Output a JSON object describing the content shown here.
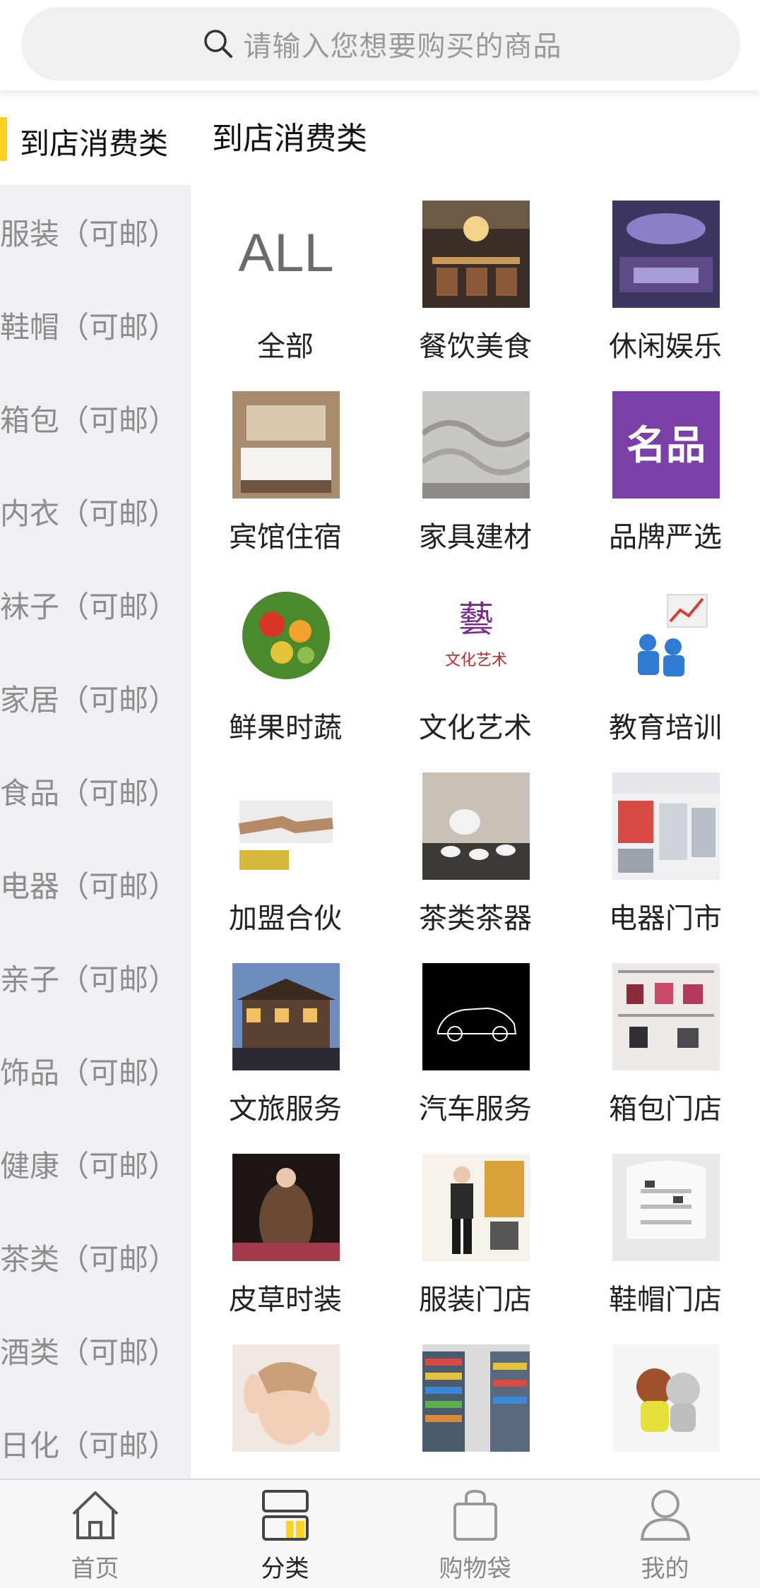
{
  "search": {
    "placeholder": "请输入您想要购买的商品",
    "icon": "search-icon"
  },
  "sidebar": {
    "active_label": "到店消费类",
    "items": [
      {
        "label": "服装（可邮）"
      },
      {
        "label": "鞋帽（可邮）"
      },
      {
        "label": "箱包（可邮）"
      },
      {
        "label": "内衣（可邮）"
      },
      {
        "label": "袜子（可邮）"
      },
      {
        "label": "家居（可邮）"
      },
      {
        "label": "食品（可邮）"
      },
      {
        "label": "电器（可邮）"
      },
      {
        "label": "亲子（可邮）"
      },
      {
        "label": "饰品（可邮）"
      },
      {
        "label": "健康（可邮）"
      },
      {
        "label": "茶类（可邮）"
      },
      {
        "label": "酒类（可邮）"
      },
      {
        "label": "日化（可邮）"
      }
    ]
  },
  "main": {
    "title": "到店消费类",
    "categories": [
      {
        "label": "全部",
        "thumb_text": "ALL"
      },
      {
        "label": "餐饮美食"
      },
      {
        "label": "休闲娱乐"
      },
      {
        "label": "宾馆住宿"
      },
      {
        "label": "家具建材"
      },
      {
        "label": "品牌严选",
        "thumb_text": "名品"
      },
      {
        "label": "鲜果时蔬"
      },
      {
        "label": "文化艺术",
        "thumb_text": "文化艺术"
      },
      {
        "label": "教育培训"
      },
      {
        "label": "加盟合伙"
      },
      {
        "label": "茶类茶器"
      },
      {
        "label": "电器门市"
      },
      {
        "label": "文旅服务"
      },
      {
        "label": "汽车服务"
      },
      {
        "label": "箱包门店"
      },
      {
        "label": "皮草时装"
      },
      {
        "label": "服装门店"
      },
      {
        "label": "鞋帽门店"
      },
      {
        "label": ""
      },
      {
        "label": ""
      },
      {
        "label": ""
      }
    ]
  },
  "tabbar": {
    "tabs": [
      {
        "label": "首页",
        "icon": "home-icon"
      },
      {
        "label": "分类",
        "icon": "category-icon",
        "active": true
      },
      {
        "label": "购物袋",
        "icon": "shopping-bag-icon"
      },
      {
        "label": "我的",
        "icon": "profile-icon"
      }
    ]
  },
  "colors": {
    "accent": "#ffd21f",
    "sidebar_bg": "#efeff4"
  }
}
